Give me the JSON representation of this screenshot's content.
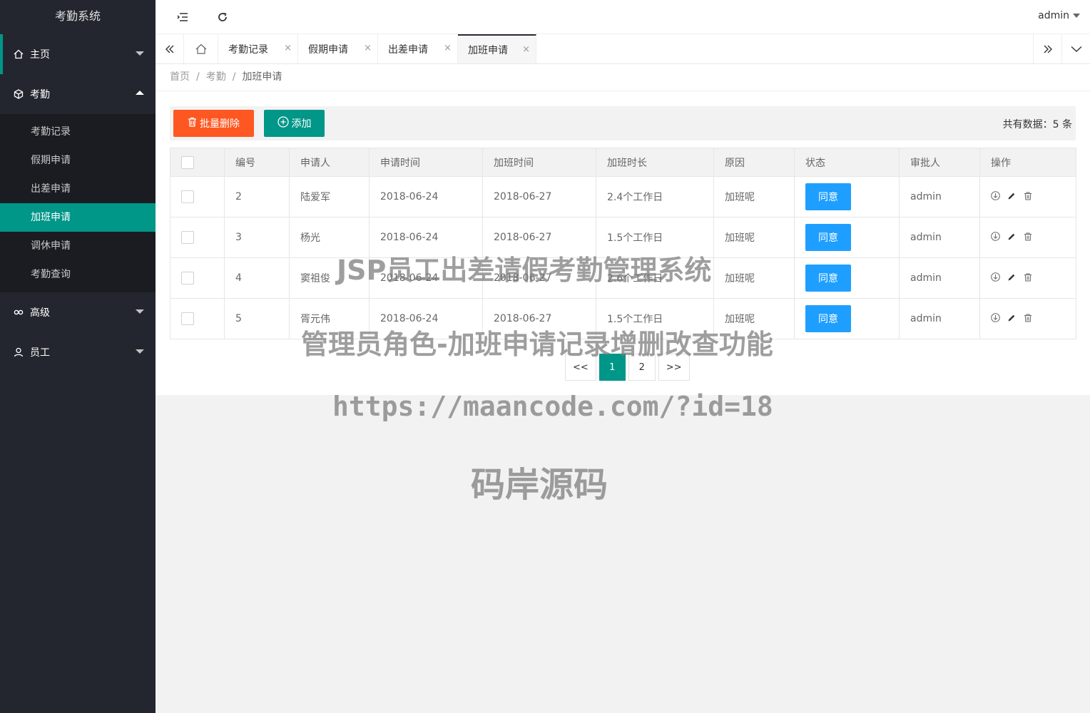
{
  "app": {
    "title": "考勤系统",
    "user": "admin"
  },
  "sidebar": {
    "home": {
      "label": "主页",
      "icon": "home-icon"
    },
    "attendance": {
      "label": "考勤",
      "icon": "cube-icon",
      "items": [
        {
          "label": "考勤记录",
          "active": false
        },
        {
          "label": "假期申请",
          "active": false
        },
        {
          "label": "出差申请",
          "active": false
        },
        {
          "label": "加班申请",
          "active": true
        },
        {
          "label": "调休申请",
          "active": false
        },
        {
          "label": "考勤查询",
          "active": false
        }
      ]
    },
    "advanced": {
      "label": "高级",
      "icon": "link-icon"
    },
    "staff": {
      "label": "员工",
      "icon": "user-icon"
    }
  },
  "tabs": [
    {
      "label": "考勤记录",
      "close": "×"
    },
    {
      "label": "假期申请",
      "close": "×"
    },
    {
      "label": "出差申请",
      "close": "×"
    },
    {
      "label": "加班申请",
      "close": "×",
      "active": true
    }
  ],
  "breadcrumb": {
    "home": "首页",
    "section": "考勤",
    "current": "加班申请",
    "sep": "/"
  },
  "toolbar": {
    "delete_label": "批量删除",
    "add_label": "添加",
    "total_label": "共有数据：5 条"
  },
  "table": {
    "headers": [
      "编号",
      "申请人",
      "申请时间",
      "加班时间",
      "加班时长",
      "原因",
      "状态",
      "审批人",
      "操作"
    ],
    "rows": [
      {
        "id": "2",
        "applicant": "陆爱军",
        "apply_time": "2018-06-24",
        "ot_time": "2018-06-27",
        "duration": "2.4个工作日",
        "reason": "加班呢",
        "status": "同意",
        "approver": "admin"
      },
      {
        "id": "3",
        "applicant": "杨光",
        "apply_time": "2018-06-24",
        "ot_time": "2018-06-27",
        "duration": "1.5个工作日",
        "reason": "加班呢",
        "status": "同意",
        "approver": "admin"
      },
      {
        "id": "4",
        "applicant": "窦祖俊",
        "apply_time": "2018-06-24",
        "ot_time": "2018-06-27",
        "duration": "2.6个工作日",
        "reason": "加班呢",
        "status": "同意",
        "approver": "admin"
      },
      {
        "id": "5",
        "applicant": "胥元伟",
        "apply_time": "2018-06-24",
        "ot_time": "2018-06-27",
        "duration": "1.5个工作日",
        "reason": "加班呢",
        "status": "同意",
        "approver": "admin"
      }
    ]
  },
  "pagination": {
    "prev": "<<",
    "pages": [
      "1",
      "2"
    ],
    "current": "1",
    "next": ">>"
  },
  "watermark": {
    "line1": "JSP员工出差请假考勤管理系统",
    "line2": "管理员角色-加班申请记录增删改查功能",
    "line3": "https://maancode.com/?id=18",
    "line4": "码岸源码"
  },
  "colors": {
    "accent": "#009688",
    "danger": "#ff5722",
    "primary": "#1e9fff",
    "sidebar": "#23262e"
  }
}
